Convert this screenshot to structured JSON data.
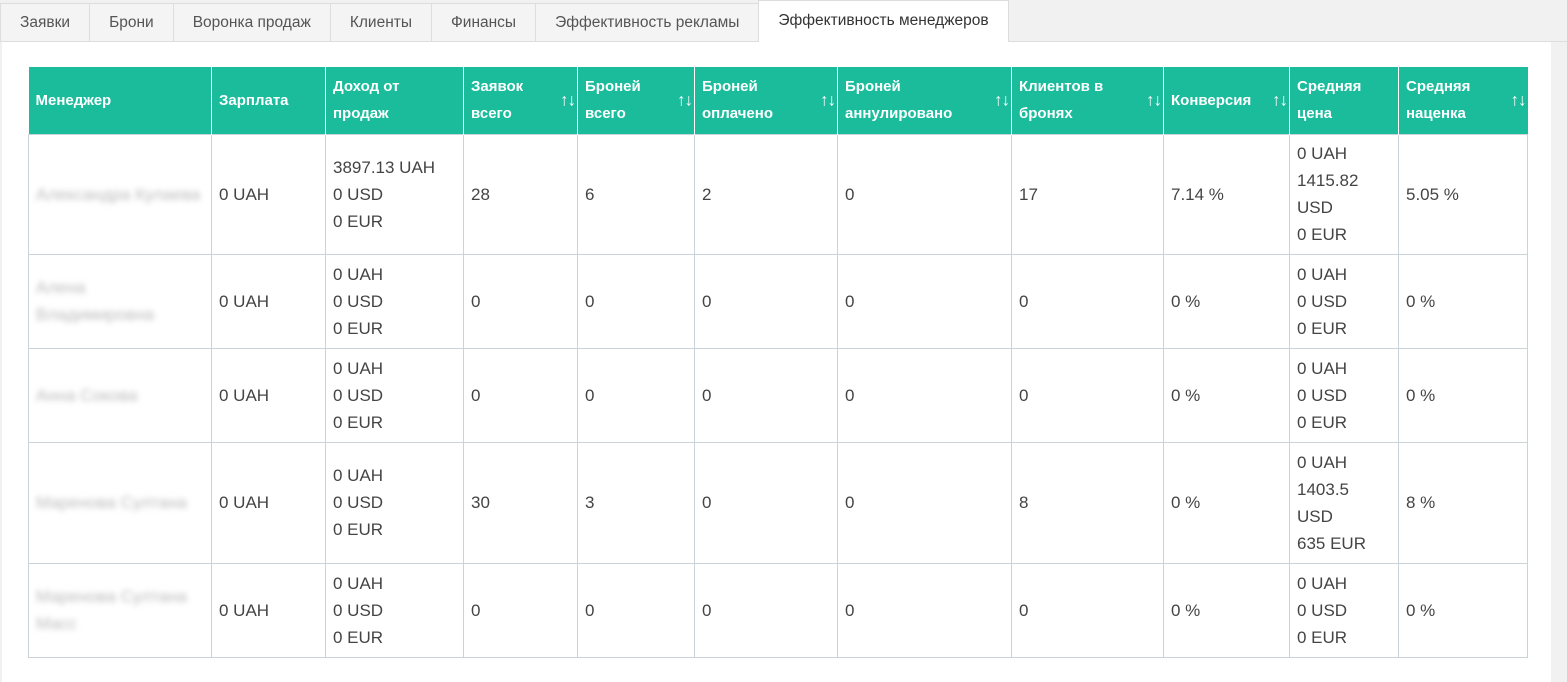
{
  "tabs": [
    {
      "label": "Заявки"
    },
    {
      "label": "Брони"
    },
    {
      "label": "Воронка продаж"
    },
    {
      "label": "Клиенты"
    },
    {
      "label": "Финансы"
    },
    {
      "label": "Эффективность рекламы"
    },
    {
      "label": "Эффективность менеджеров"
    }
  ],
  "active_tab_index": 6,
  "colors": {
    "header_bg": "#1abc9c",
    "header_text": "#ffffff",
    "border": "#c9d3d8"
  },
  "icons": {
    "sort": "sort-arrows-icon"
  },
  "table": {
    "columns": [
      {
        "label": "Менеджер",
        "sortable": false
      },
      {
        "label": "Зарплата",
        "sortable": false
      },
      {
        "label": "Доход от продаж",
        "sortable": false
      },
      {
        "label": "Заявок всего",
        "sortable": true
      },
      {
        "label": "Броней всего",
        "sortable": true
      },
      {
        "label": "Броней оплачено",
        "sortable": true
      },
      {
        "label": "Броней аннулировано",
        "sortable": true
      },
      {
        "label": "Клиентов в бронях",
        "sortable": true
      },
      {
        "label": "Конверсия",
        "sortable": true
      },
      {
        "label": "Средняя цена",
        "sortable": false
      },
      {
        "label": "Средняя наценка",
        "sortable": true
      }
    ],
    "sort_glyph": "↑↓",
    "rows": [
      {
        "manager": "Александра Кулаева",
        "salary": "0 UAH",
        "income": [
          "3897.13 UAH",
          "0 USD",
          "0 EUR"
        ],
        "requests": "28",
        "bookings": "6",
        "paid": "2",
        "cancelled": "0",
        "clients": "17",
        "conversion": "7.14 %",
        "avg_price": [
          "0 UAH",
          "1415.82",
          "USD",
          "0 EUR"
        ],
        "avg_markup": "5.05 %"
      },
      {
        "manager": "Алена Владимировна",
        "salary": "0 UAH",
        "income": [
          "0 UAH",
          "0 USD",
          "0 EUR"
        ],
        "requests": "0",
        "bookings": "0",
        "paid": "0",
        "cancelled": "0",
        "clients": "0",
        "conversion": "0 %",
        "avg_price": [
          "0 UAH",
          "0 USD",
          "0 EUR"
        ],
        "avg_markup": "0 %"
      },
      {
        "manager": "Анна Сокова",
        "salary": "0 UAH",
        "income": [
          "0 UAH",
          "0 USD",
          "0 EUR"
        ],
        "requests": "0",
        "bookings": "0",
        "paid": "0",
        "cancelled": "0",
        "clients": "0",
        "conversion": "0 %",
        "avg_price": [
          "0 UAH",
          "0 USD",
          "0 EUR"
        ],
        "avg_markup": "0 %"
      },
      {
        "manager": "Маренова Султана",
        "salary": "0 UAH",
        "income": [
          "0 UAH",
          "0 USD",
          "0 EUR"
        ],
        "requests": "30",
        "bookings": "3",
        "paid": "0",
        "cancelled": "0",
        "clients": "8",
        "conversion": "0 %",
        "avg_price": [
          "0 UAH",
          "1403.5",
          "USD",
          "635 EUR"
        ],
        "avg_markup": "8 %"
      },
      {
        "manager": "Маренова Султана Масс",
        "salary": "0 UAH",
        "income": [
          "0 UAH",
          "0 USD",
          "0 EUR"
        ],
        "requests": "0",
        "bookings": "0",
        "paid": "0",
        "cancelled": "0",
        "clients": "0",
        "conversion": "0 %",
        "avg_price": [
          "0 UAH",
          "0 USD",
          "0 EUR"
        ],
        "avg_markup": "0 %"
      }
    ]
  }
}
